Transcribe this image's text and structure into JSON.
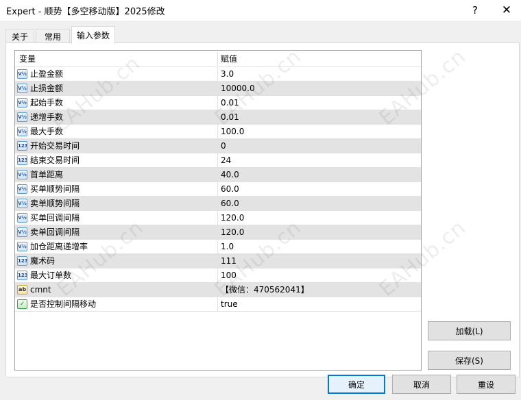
{
  "window": {
    "title": "Expert - 顺势【多空移动版】2025修改",
    "help_label": "?",
    "close_label": "✕"
  },
  "tabs": [
    {
      "label": "关于"
    },
    {
      "label": "常用"
    },
    {
      "label": "输入参数"
    }
  ],
  "grid": {
    "headers": {
      "variable": "变量",
      "value": "赋值"
    },
    "rows": [
      {
        "name": "止盈金额",
        "value": "3.0",
        "type_icon": "double-icon",
        "type_glyph": "V½"
      },
      {
        "name": "止损金额",
        "value": "10000.0",
        "type_icon": "double-icon",
        "type_glyph": "V½"
      },
      {
        "name": "起始手数",
        "value": "0.01",
        "type_icon": "double-icon",
        "type_glyph": "V½"
      },
      {
        "name": "递增手数",
        "value": "0.01",
        "type_icon": "double-icon",
        "type_glyph": "V½"
      },
      {
        "name": "最大手数",
        "value": "100.0",
        "type_icon": "double-icon",
        "type_glyph": "V½"
      },
      {
        "name": "开始交易时间",
        "value": "0",
        "type_icon": "integer-icon",
        "type_glyph": "123"
      },
      {
        "name": "结束交易时间",
        "value": "24",
        "type_icon": "integer-icon",
        "type_glyph": "123"
      },
      {
        "name": "首单距离",
        "value": "40.0",
        "type_icon": "double-icon",
        "type_glyph": "V½"
      },
      {
        "name": "买单顺势间隔",
        "value": "60.0",
        "type_icon": "double-icon",
        "type_glyph": "V½"
      },
      {
        "name": "卖单顺势间隔",
        "value": "60.0",
        "type_icon": "double-icon",
        "type_glyph": "V½"
      },
      {
        "name": "买单回调间隔",
        "value": "120.0",
        "type_icon": "double-icon",
        "type_glyph": "V½"
      },
      {
        "name": "卖单回调间隔",
        "value": "120.0",
        "type_icon": "double-icon",
        "type_glyph": "V½"
      },
      {
        "name": "加仓距离递增率",
        "value": "1.0",
        "type_icon": "double-icon",
        "type_glyph": "V½"
      },
      {
        "name": "魔术码",
        "value": "111",
        "type_icon": "integer-icon",
        "type_glyph": "123"
      },
      {
        "name": "最大订单数",
        "value": "100",
        "type_icon": "integer-icon",
        "type_glyph": "123"
      },
      {
        "name": "cmnt",
        "value": "【微信：470562041】",
        "type_icon": "string-icon",
        "type_glyph": "ab"
      },
      {
        "name": "是否控制间隔移动",
        "value": "true",
        "type_icon": "bool-icon",
        "type_glyph": "✓"
      }
    ]
  },
  "buttons": {
    "load": "加载(L)",
    "save": "保存(S)",
    "ok": "确定",
    "cancel": "取消",
    "reset": "重设"
  },
  "watermark": "EAHub.cn",
  "colors": {
    "accent": "#0078d7",
    "alt_row": "#e3e3e3"
  }
}
